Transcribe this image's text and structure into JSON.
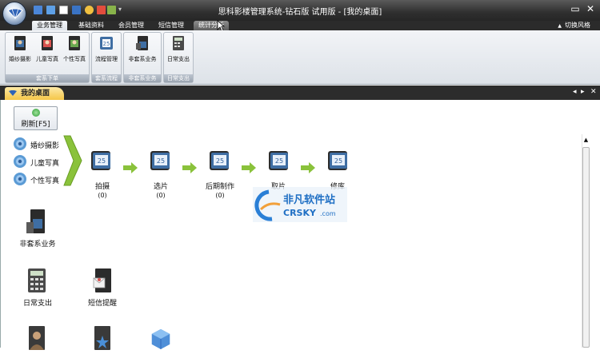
{
  "window": {
    "title": "思科影楼管理系统-钻石版 试用版 - [我的桌面]",
    "minimize_glyph": "▭",
    "close_glyph": "✕"
  },
  "ribbon": {
    "tabs": [
      {
        "label": "业务管理",
        "state": "active"
      },
      {
        "label": "基础资料",
        "state": "normal"
      },
      {
        "label": "会员管理",
        "state": "normal"
      },
      {
        "label": "短信管理",
        "state": "normal"
      },
      {
        "label": "统计分析",
        "state": "hover"
      }
    ],
    "style_switch": {
      "glyph": "▲",
      "label": "切换风格"
    },
    "groups": [
      {
        "caption": "套系下单",
        "buttons": [
          "婚纱摄影",
          "儿童写真",
          "个性写真"
        ]
      },
      {
        "caption": "套系流程",
        "buttons": [
          "流程管理"
        ]
      },
      {
        "caption": "非套系业务",
        "buttons": [
          "非套系业务"
        ]
      },
      {
        "caption": "日常支出",
        "buttons": [
          "日常支出"
        ]
      }
    ]
  },
  "doc_tab": {
    "label": "我的桌面"
  },
  "doc_nav": {
    "prev": "◂",
    "next": "▸",
    "close": "✕"
  },
  "desktop": {
    "refresh_label": "刷新[F5]",
    "categories": [
      "婚纱摄影",
      "儿童写真",
      "个性写真"
    ],
    "process_steps": [
      {
        "label": "拍摄",
        "count": "(0)"
      },
      {
        "label": "选片",
        "count": "(0)"
      },
      {
        "label": "后期制作",
        "count": "(0)"
      },
      {
        "label": "取片",
        "count": ""
      },
      {
        "label": "修库",
        "count": ""
      }
    ],
    "icons": [
      {
        "label": "非套系业务"
      },
      {
        "label": "日常支出"
      },
      {
        "label": "短信提醒"
      }
    ],
    "scroll_up_glyph": "▲"
  },
  "watermark": {
    "cn": "非凡软件站",
    "en": "CRSKY",
    "dotcom": ".com"
  },
  "colors": {
    "titlebar": "#333333",
    "ribbon": "#e3e7ec",
    "doc_tab": "#f5c648",
    "arrow": "#8ac23b",
    "folder": "#3f6ea3"
  }
}
